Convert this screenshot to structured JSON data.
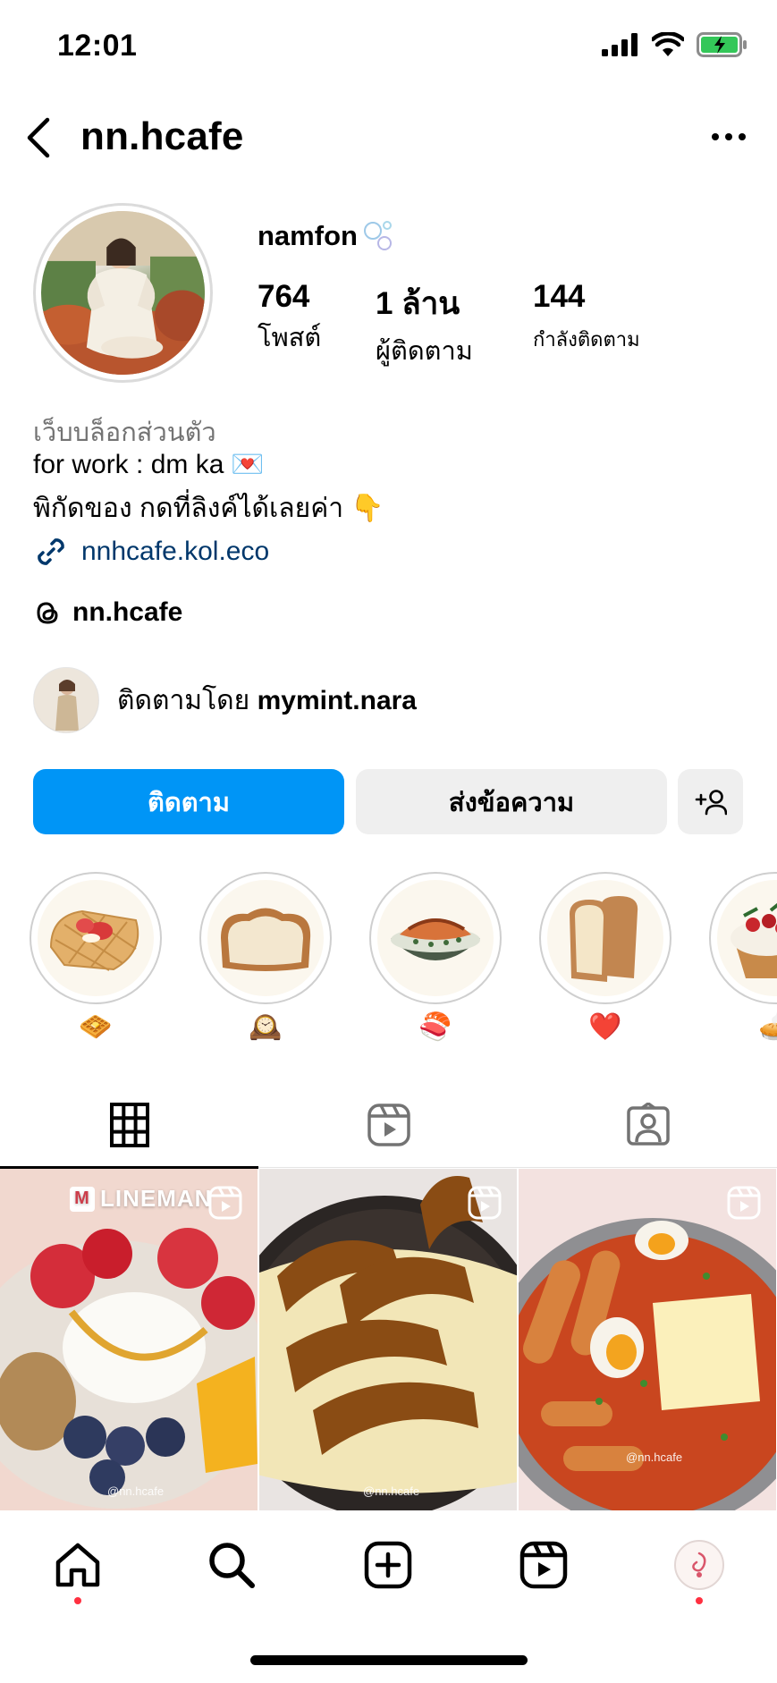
{
  "status_bar": {
    "time": "12:01"
  },
  "header": {
    "username": "nn.hcafe",
    "back_icon": "chevron-left-icon",
    "more_icon": "more-horizontal-icon"
  },
  "profile": {
    "display_name": "namfon",
    "display_name_emoji": "bubbles",
    "stats": [
      {
        "value": "764",
        "label": "โพสต์"
      },
      {
        "value": "1 ล้าน",
        "label": "ผู้ติดตาม"
      },
      {
        "value": "144",
        "label": "กำลังติดตาม"
      }
    ]
  },
  "bio": {
    "category": "เว็บบล็อกส่วนตัว",
    "line1": "for work : dm ka",
    "line1_emoji": "💌",
    "line2": "พิกัดของ กดที่ลิงค์ได้เลยค่า",
    "line2_emoji": "👇",
    "link": "nnhcafe.kol.eco",
    "threads_handle": "nn.hcafe"
  },
  "followed_by": {
    "prefix": "ติดตามโดย",
    "username": "mymint.nara"
  },
  "actions": {
    "follow": "ติดตาม",
    "message": "ส่งข้อความ"
  },
  "highlights": [
    {
      "label": "🧇",
      "name": "waffle"
    },
    {
      "label": "🕰️",
      "name": "bread"
    },
    {
      "label": "🍣",
      "name": "salmon-bowl"
    },
    {
      "label": "❤️",
      "name": "toast"
    },
    {
      "label": "🥧",
      "name": "cupcake"
    }
  ],
  "tabs": [
    "grid",
    "reels",
    "tagged"
  ],
  "posts": [
    {
      "badge": "LINEMAN",
      "watermark": "@nn.hcafe"
    },
    {
      "watermark": "@nn.hcafe"
    },
    {
      "watermark": "@nn.hcafe"
    }
  ],
  "colors": {
    "primary": "#0095f6",
    "secondary_button": "#efefef",
    "link": "#00376b",
    "muted_text": "#737373",
    "notification_dot": "#ff3040"
  }
}
